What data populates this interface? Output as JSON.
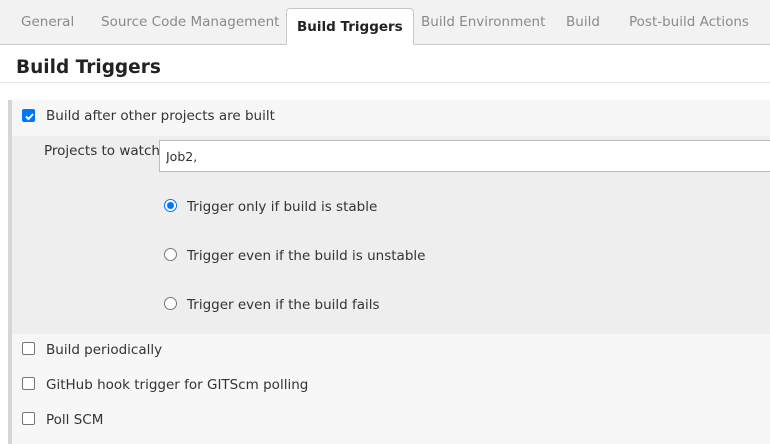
{
  "tabs": [
    {
      "label": "General",
      "active": false
    },
    {
      "label": "Source Code Management",
      "active": false
    },
    {
      "label": "Build Triggers",
      "active": true
    },
    {
      "label": "Build Environment",
      "active": false
    },
    {
      "label": "Build",
      "active": false
    },
    {
      "label": "Post-build Actions",
      "active": false
    }
  ],
  "section_title": "Build Triggers",
  "triggers": {
    "build_after_other": {
      "label": "Build after other projects are built",
      "checked": true
    },
    "projects_to_watch": {
      "label": "Projects to watch",
      "value": "Job2,"
    },
    "radio_options": [
      {
        "label": "Trigger only if build is stable",
        "selected": true
      },
      {
        "label": "Trigger even if the build is unstable",
        "selected": false
      },
      {
        "label": "Trigger even if the build fails",
        "selected": false
      }
    ],
    "build_periodically": {
      "label": "Build periodically",
      "checked": false
    },
    "github_hook": {
      "label": "GitHub hook trigger for GITScm polling",
      "checked": false
    },
    "poll_scm": {
      "label": "Poll SCM",
      "checked": false
    }
  },
  "colors": {
    "accent": "#0075ff",
    "tabbar_bg": "#f2f2f2",
    "panel_bg": "#f7f7f7",
    "nested_bg": "#eeeeee"
  }
}
